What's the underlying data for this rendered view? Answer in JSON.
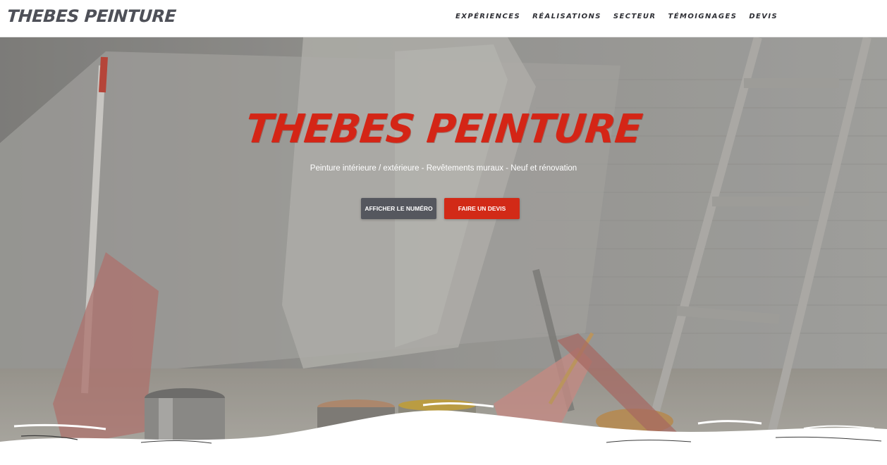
{
  "header": {
    "logo": "THEBES PEINTURE",
    "nav": [
      "EXPÉRIENCES",
      "RÉALISATIONS",
      "SECTEUR",
      "TÉMOIGNAGES",
      "DEVIS"
    ]
  },
  "hero": {
    "title": "THEBES PEINTURE",
    "subtitle": "Peinture intérieure / extérieure - Revêtements muraux - Neuf et rénovation",
    "buttons": {
      "number_label": "AFFICHER LE NUMÉRO",
      "quote_label": "FAIRE UN DEVIS"
    }
  },
  "colors": {
    "accent": "#d22a17",
    "dark_button": "#55575e",
    "logo": "#4e5058"
  }
}
